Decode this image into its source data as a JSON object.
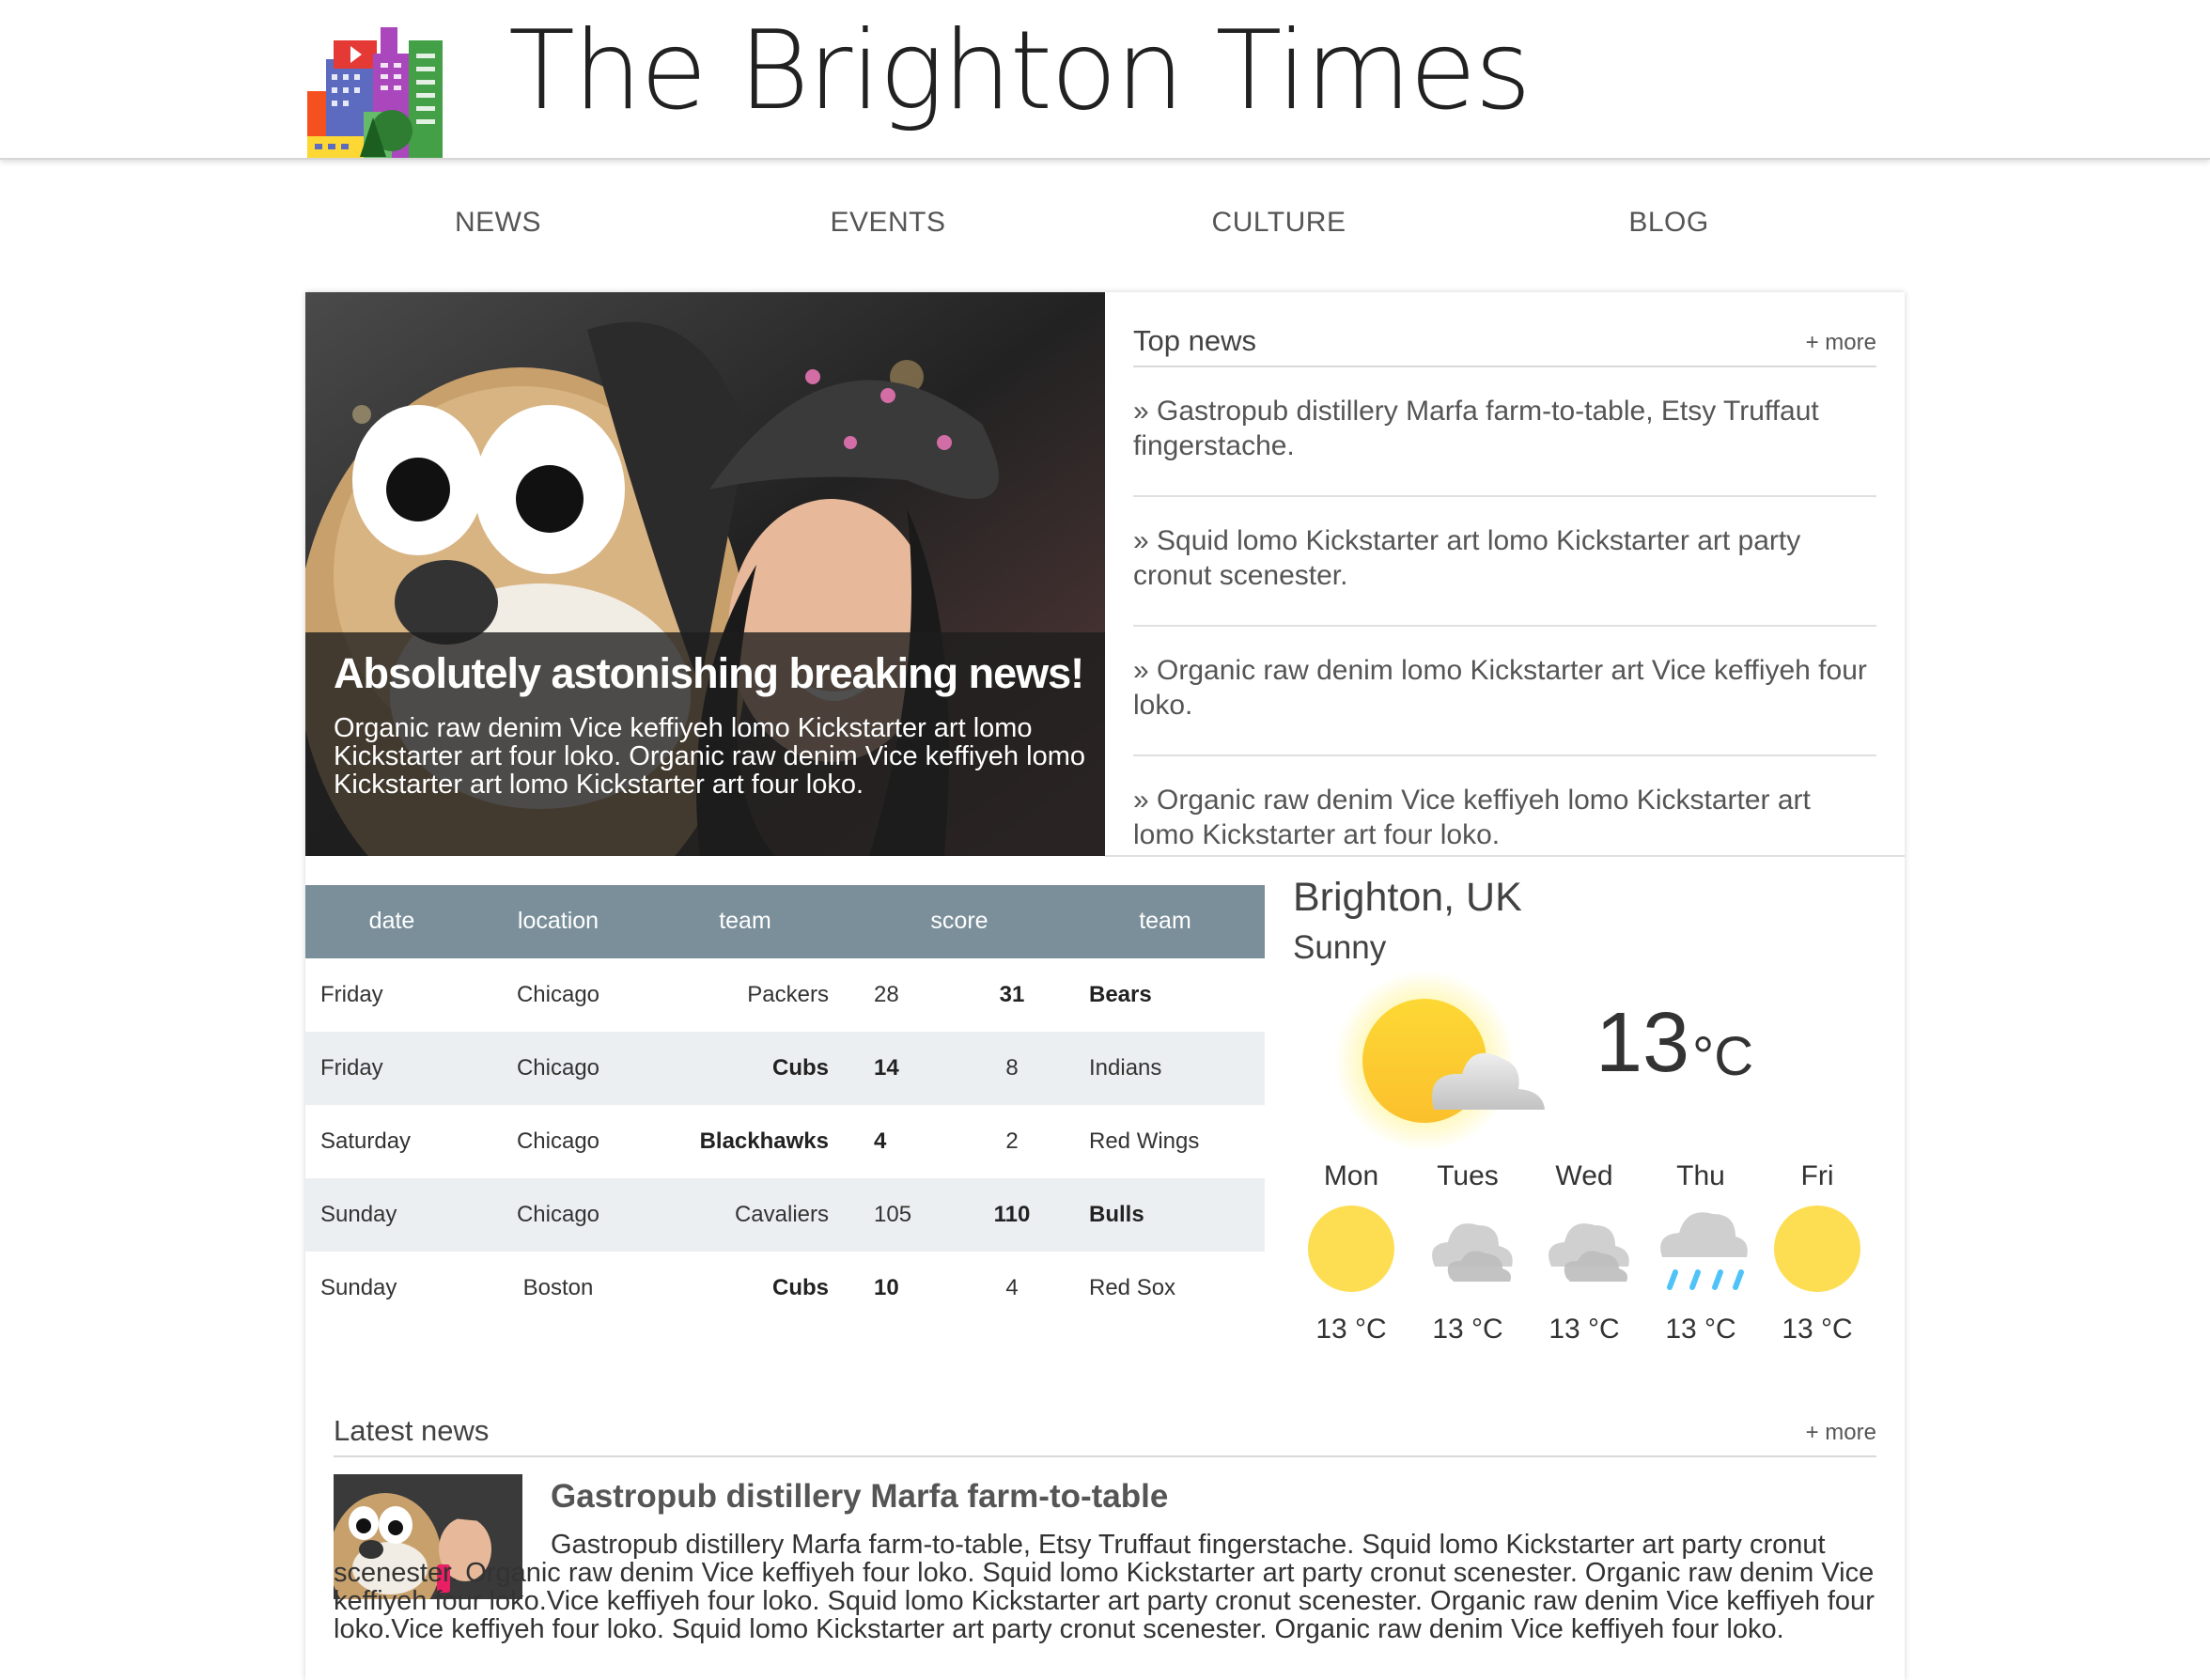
{
  "site": {
    "title": "The Brighton Times"
  },
  "nav": {
    "items": [
      "NEWS",
      "EVENTS",
      "CULTURE",
      "BLOG"
    ]
  },
  "hero": {
    "title": "Absolutely astonishing breaking news!",
    "body": "Organic raw denim Vice keffiyeh lomo Kickstarter art lomo Kickstarter art four loko. Organic raw denim Vice keffiyeh lomo Kickstarter art lomo Kickstarter art four loko."
  },
  "top_news": {
    "heading": "Top news",
    "more": "+ more",
    "items": [
      "» Gastropub distillery Marfa farm-to-table, Etsy Truffaut fingerstache.",
      "» Squid lomo Kickstarter art lomo Kickstarter art party cronut scenester.",
      "» Organic raw denim lomo Kickstarter art Vice keffiyeh four loko.",
      "» Organic raw denim Vice keffiyeh lomo Kickstarter art lomo Kickstarter art four loko."
    ]
  },
  "scores": {
    "headers": [
      "date",
      "location",
      "team",
      "score",
      "team"
    ],
    "rows": [
      {
        "date": "Friday",
        "location": "Chicago",
        "team1": "Packers",
        "score1": "28",
        "score2": "31",
        "team2": "Bears",
        "winner": 2
      },
      {
        "date": "Friday",
        "location": "Chicago",
        "team1": "Cubs",
        "score1": "14",
        "score2": "8",
        "team2": "Indians",
        "winner": 1
      },
      {
        "date": "Saturday",
        "location": "Chicago",
        "team1": "Blackhawks",
        "score1": "4",
        "score2": "2",
        "team2": "Red Wings",
        "winner": 1
      },
      {
        "date": "Sunday",
        "location": "Chicago",
        "team1": "Cavaliers",
        "score1": "105",
        "score2": "110",
        "team2": "Bulls",
        "winner": 2
      },
      {
        "date": "Sunday",
        "location": "Boston",
        "team1": "Cubs",
        "score1": "10",
        "score2": "4",
        "team2": "Red Sox",
        "winner": 1
      }
    ]
  },
  "weather": {
    "city": "Brighton, UK",
    "condition": "Sunny",
    "temp": "13",
    "unit": "°C",
    "current_icon": "sun-cloud-icon",
    "forecast": [
      {
        "day": "Mon",
        "icon": "sun-icon",
        "temp": "13 °C"
      },
      {
        "day": "Tues",
        "icon": "cloudy-icon",
        "temp": "13 °C"
      },
      {
        "day": "Wed",
        "icon": "cloudy-icon",
        "temp": "13 °C"
      },
      {
        "day": "Thu",
        "icon": "rain-icon",
        "temp": "13 °C"
      },
      {
        "day": "Fri",
        "icon": "sun-icon",
        "temp": "13 °C"
      }
    ]
  },
  "latest": {
    "heading": "Latest news",
    "more": "+ more",
    "title": "Gastropub distillery Marfa farm-to-table",
    "body": "Gastropub distillery Marfa farm-to-table, Etsy Truffaut fingerstache. Squid lomo Kickstarter art party cronut scenester. Organic raw denim Vice keffiyeh four loko. Squid lomo Kickstarter art party cronut scenester. Organic raw denim Vice keffiyeh four loko.Vice keffiyeh four loko. Squid lomo Kickstarter art party cronut scenester. Organic raw denim Vice keffiyeh four loko.Vice keffiyeh four loko. Squid lomo Kickstarter art party cronut scenester. Organic raw denim Vice keffiyeh four loko."
  },
  "colors": {
    "table_header": "#7a8f9a",
    "row_alt": "#eceff1",
    "sun": "#fdd835",
    "cloud": "#cfcfcf",
    "rain": "#4fc3f7"
  }
}
